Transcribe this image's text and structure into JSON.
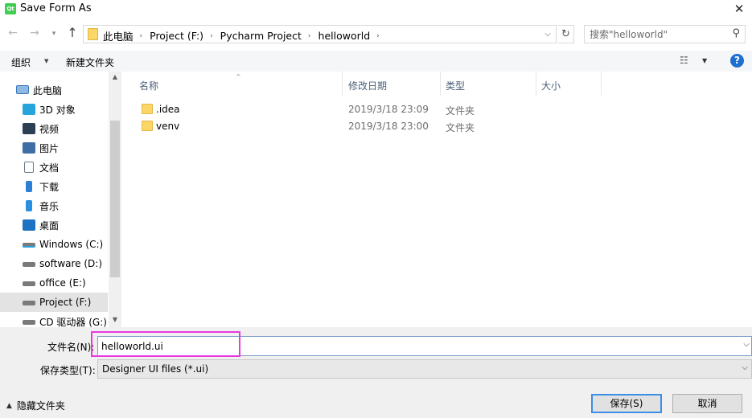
{
  "window": {
    "title": "Save Form As",
    "app_icon_text": "Qt",
    "close_glyph": "✕"
  },
  "nav": {
    "back_glyph": "←",
    "forward_glyph": "→",
    "recent_glyph": "▾",
    "up_glyph": "↑"
  },
  "address": {
    "crumbs": [
      "此电脑",
      "Project (F:)",
      "Pycharm Project",
      "helloworld"
    ],
    "separator": "›",
    "dropdown_glyph": "⌵",
    "refresh_glyph": "↻"
  },
  "search": {
    "placeholder": "搜索\"helloworld\"",
    "icon_glyph": "⚲"
  },
  "toolbar": {
    "organize_label": "组织",
    "organize_arrow": "▼",
    "new_folder_label": "新建文件夹",
    "view_glyph": "☷",
    "view_arrow": "▼",
    "help_glyph": "?"
  },
  "nav_pane": {
    "items": [
      {
        "label": "此电脑",
        "icon": "computer-icon",
        "color": "#2f7fc9"
      },
      {
        "label": "3D 对象",
        "icon": "3d-objects-icon",
        "color": "#26a5dd"
      },
      {
        "label": "视频",
        "icon": "videos-icon",
        "color": "#2d3f55"
      },
      {
        "label": "图片",
        "icon": "pictures-icon",
        "color": "#3e6ea3"
      },
      {
        "label": "文档",
        "icon": "documents-icon",
        "color": "#6b7a8a"
      },
      {
        "label": "下载",
        "icon": "downloads-icon",
        "color": "#2b7fd4"
      },
      {
        "label": "音乐",
        "icon": "music-icon",
        "color": "#2b8fe0"
      },
      {
        "label": "桌面",
        "icon": "desktop-icon",
        "color": "#1d73c2"
      },
      {
        "label": "Windows (C:)",
        "icon": "windows-drive-icon",
        "color": "#6b6b6b"
      },
      {
        "label": "software (D:)",
        "icon": "drive-icon",
        "color": "#6b6b6b"
      },
      {
        "label": "office (E:)",
        "icon": "drive-icon",
        "color": "#6b6b6b"
      },
      {
        "label": "Project (F:)",
        "icon": "drive-icon",
        "color": "#6b6b6b",
        "selected": true
      },
      {
        "label": "CD 驱动器 (G:)",
        "icon": "cd-drive-icon",
        "color": "#6b6b6b"
      }
    ],
    "scroll_up_glyph": "▲",
    "scroll_down_glyph": "▼"
  },
  "file_list": {
    "columns": [
      "名称",
      "修改日期",
      "类型",
      "大小"
    ],
    "sort_glyph": "^",
    "rows": [
      {
        "name": ".idea",
        "date": "2019/3/18 23:09",
        "type": "文件夹",
        "size": ""
      },
      {
        "name": "venv",
        "date": "2019/3/18 23:00",
        "type": "文件夹",
        "size": ""
      }
    ]
  },
  "form": {
    "filename_label": "文件名(N):",
    "filename_value": "helloworld.ui",
    "filename_dropdown_glyph": "⌵",
    "filetype_label": "保存类型(T):",
    "filetype_value": "Designer UI files (*.ui)",
    "filetype_dropdown_glyph": "⌵",
    "highlight_color": "#e83adf"
  },
  "footer": {
    "hide_folders_glyph": "▲",
    "hide_folders_label": "隐藏文件夹",
    "save_label": "保存(S)",
    "cancel_label": "取消"
  }
}
